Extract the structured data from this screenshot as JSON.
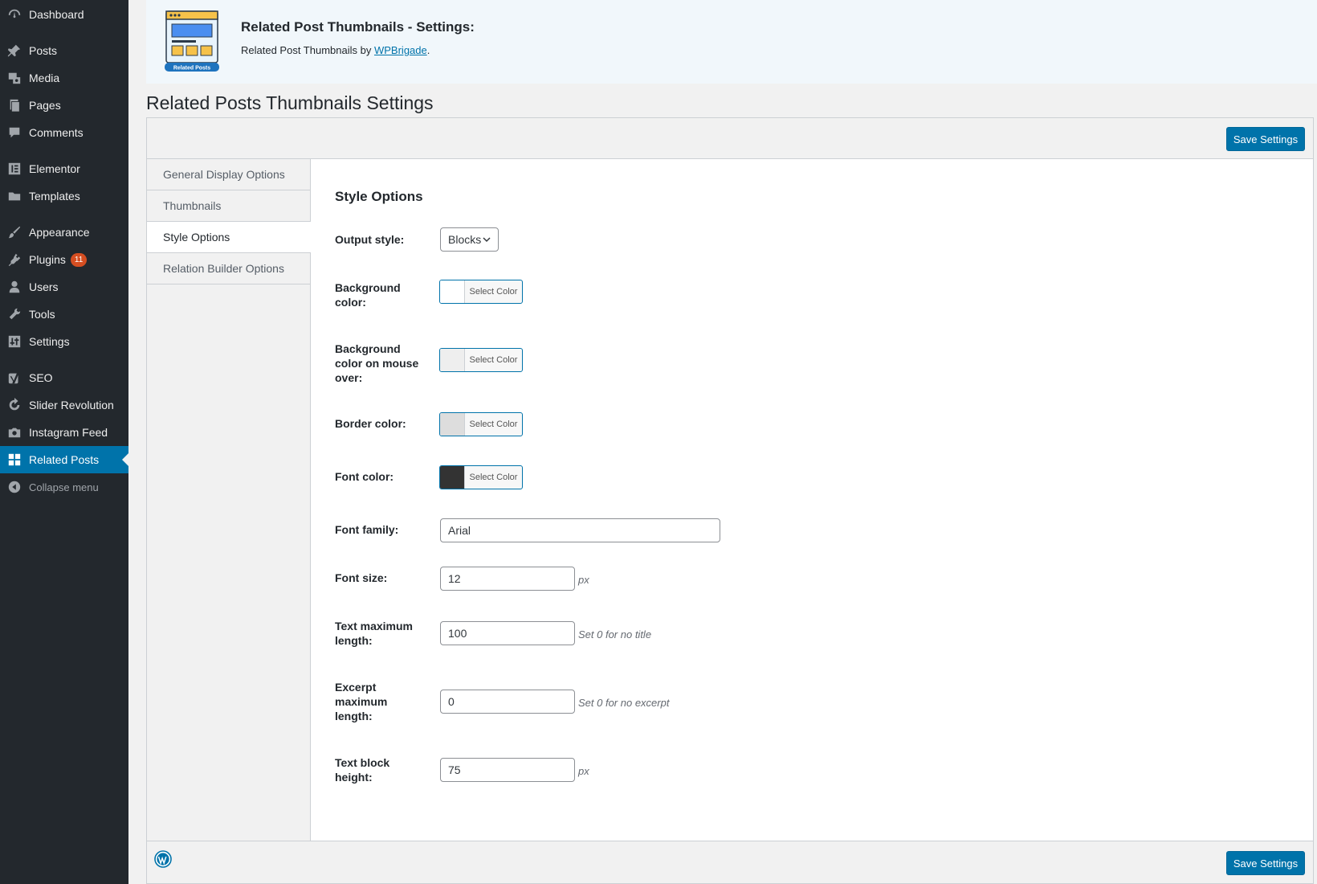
{
  "sidebar": {
    "items": [
      {
        "label": "Dashboard",
        "icon": "dashboard-icon"
      },
      {
        "label": "Posts",
        "icon": "pin-icon"
      },
      {
        "label": "Media",
        "icon": "media-icon"
      },
      {
        "label": "Pages",
        "icon": "pages-icon"
      },
      {
        "label": "Comments",
        "icon": "comment-icon"
      },
      {
        "label": "Elementor",
        "icon": "elementor-icon"
      },
      {
        "label": "Templates",
        "icon": "folder-icon"
      },
      {
        "label": "Appearance",
        "icon": "paintbrush-icon"
      },
      {
        "label": "Plugins",
        "icon": "plugin-icon",
        "badge": "11"
      },
      {
        "label": "Users",
        "icon": "user-icon"
      },
      {
        "label": "Tools",
        "icon": "wrench-icon"
      },
      {
        "label": "Settings",
        "icon": "sliders-icon"
      },
      {
        "label": "SEO",
        "icon": "yoast-icon"
      },
      {
        "label": "Slider Revolution",
        "icon": "refresh-icon"
      },
      {
        "label": "Instagram Feed",
        "icon": "camera-icon"
      },
      {
        "label": "Related Posts",
        "icon": "grid-icon",
        "current": true
      }
    ],
    "collapse_label": "Collapse menu"
  },
  "plugin_header": {
    "title": "Related Post Thumbnails - Settings:",
    "by_prefix": "Related Post Thumbnails by",
    "author_link": "WPBrigade",
    "by_suffix": ".",
    "logo_caption": "Related Posts"
  },
  "page_title": "Related Posts Thumbnails Settings",
  "save_label": "Save Settings",
  "tabs": [
    {
      "label": "General Display Options"
    },
    {
      "label": "Thumbnails"
    },
    {
      "label": "Style Options",
      "active": true
    },
    {
      "label": "Relation Builder Options"
    }
  ],
  "section_title": "Style Options",
  "fields": {
    "output_style": {
      "label": "Output style:",
      "value": "Blocks"
    },
    "background_color": {
      "label": "Background color:",
      "button_text": "Select Color",
      "color": "#ffffff"
    },
    "background_hover": {
      "label": "Background color on mouse over:",
      "button_text": "Select Color",
      "color": "#eeeeee"
    },
    "border_color": {
      "label": "Border color:",
      "button_text": "Select Color",
      "color": "#dddddd"
    },
    "font_color": {
      "label": "Font color:",
      "button_text": "Select Color",
      "color": "#333333"
    },
    "font_family": {
      "label": "Font family:",
      "value": "Arial"
    },
    "font_size": {
      "label": "Font size:",
      "value": "12",
      "hint": "px"
    },
    "text_max_length": {
      "label": "Text maximum length:",
      "value": "100",
      "hint": "Set 0 for no title"
    },
    "excerpt_max_length": {
      "label": "Excerpt maximum length:",
      "value": "0",
      "hint": "Set 0 for no excerpt"
    },
    "text_block_height": {
      "label": "Text block height:",
      "value": "75",
      "hint": "px"
    }
  },
  "colors": {
    "sidebar_bg": "#23282d",
    "accent": "#0073aa",
    "badge": "#d54e21"
  }
}
